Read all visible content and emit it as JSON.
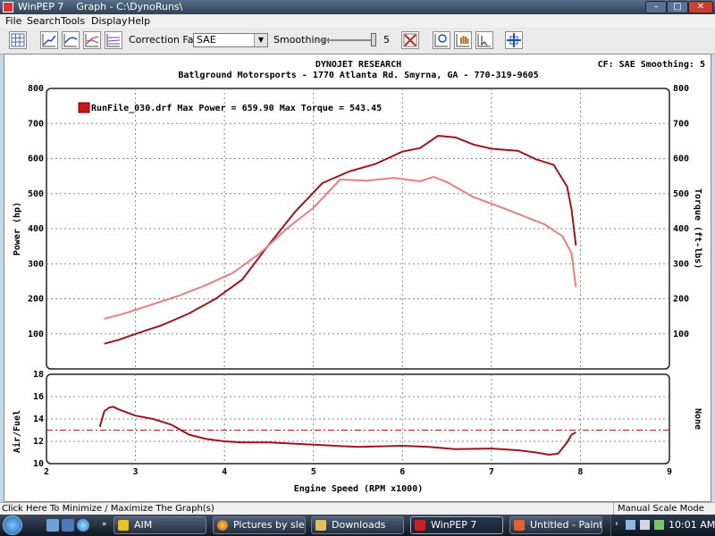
{
  "window": {
    "title": "WinPEP 7    Graph - C:\\DynoRuns\\"
  },
  "menu": [
    "File",
    "Search",
    "Tools",
    "Display",
    "Help"
  ],
  "toolbar": {
    "correction_label": "Correction Factor:",
    "correction_value": "SAE",
    "smoothing_label": "Smoothing:",
    "smoothing_value": "5"
  },
  "graph": {
    "header_title": "DYNOJET RESEARCH",
    "header_sub": "Batlground Motorsports - 1770 Atlanta Rd. Smyrna, GA - 770-319-9605",
    "cf_info": "CF: SAE  Smoothing: 5",
    "legend_text": "RunFile_030.drf Max Power = 659.90 Max Torque = 543.45",
    "colors": {
      "power": "#a0141e",
      "torque": "#e77f7f",
      "afr": "#a0141e",
      "afr_ref": "#c0141e"
    }
  },
  "chart_data": [
    {
      "type": "line",
      "xlabel": "Engine Speed (RPM x1000)",
      "ylabel": "Power (hp)",
      "y2label": "Torque (ft-lbs)",
      "xlim": [
        2,
        9
      ],
      "ylim": [
        0,
        800
      ],
      "y2lim": [
        0,
        800
      ],
      "y_ticks": [
        100,
        200,
        300,
        400,
        500,
        600,
        700,
        800
      ],
      "grid": true,
      "legend_position": "top-left",
      "series": [
        {
          "name": "Power",
          "x": [
            2.65,
            2.8,
            3.0,
            3.3,
            3.6,
            3.9,
            4.2,
            4.5,
            4.8,
            5.1,
            5.4,
            5.7,
            6.0,
            6.2,
            6.4,
            6.6,
            6.8,
            7.0,
            7.3,
            7.5,
            7.7,
            7.85,
            7.9,
            7.95
          ],
          "values": [
            72,
            82,
            100,
            125,
            158,
            200,
            255,
            355,
            450,
            530,
            563,
            585,
            620,
            630,
            665,
            660,
            640,
            628,
            622,
            598,
            582,
            520,
            455,
            352
          ]
        },
        {
          "name": "Torque",
          "x": [
            2.65,
            2.9,
            3.2,
            3.5,
            3.8,
            4.1,
            4.4,
            4.7,
            5.0,
            5.3,
            5.6,
            5.9,
            6.2,
            6.35,
            6.5,
            6.8,
            7.1,
            7.4,
            7.6,
            7.8,
            7.9,
            7.95
          ],
          "values": [
            143,
            160,
            185,
            210,
            240,
            275,
            330,
            400,
            460,
            540,
            537,
            545,
            535,
            548,
            533,
            490,
            462,
            432,
            412,
            378,
            330,
            233
          ]
        }
      ]
    },
    {
      "type": "line",
      "xlabel": "Engine Speed (RPM x1000)",
      "ylabel": "Air/Fuel",
      "y2label": "None",
      "xlim": [
        2,
        9
      ],
      "ylim": [
        10,
        18
      ],
      "x_ticks": [
        2,
        3,
        4,
        5,
        6,
        7,
        8,
        9
      ],
      "y_ticks": [
        10,
        12,
        14,
        16,
        18
      ],
      "reference_line": 13,
      "grid": true,
      "series": [
        {
          "name": "Air/Fuel",
          "x": [
            2.6,
            2.65,
            2.7,
            2.75,
            2.8,
            3.0,
            3.2,
            3.4,
            3.6,
            3.8,
            4.0,
            4.2,
            4.5,
            5.0,
            5.5,
            6.0,
            6.3,
            6.6,
            7.0,
            7.3,
            7.5,
            7.65,
            7.75,
            7.85,
            7.9,
            7.95
          ],
          "values": [
            13.3,
            14.7,
            15.0,
            15.1,
            14.9,
            14.3,
            14.0,
            13.5,
            12.6,
            12.2,
            12.0,
            11.9,
            11.9,
            11.7,
            11.5,
            11.6,
            11.5,
            11.3,
            11.35,
            11.2,
            11.0,
            10.8,
            10.9,
            11.9,
            12.6,
            12.8
          ]
        }
      ]
    }
  ],
  "statusbar": {
    "left": "Click Here To Minimize / Maximize The Graph(s)",
    "right": "Manual Scale Mode"
  },
  "taskbar": {
    "items": [
      "AIM",
      "Pictures by sleep...",
      "Downloads",
      "WinPEP 7",
      "Untitled - Paint"
    ],
    "clock": "10:01 AM"
  }
}
